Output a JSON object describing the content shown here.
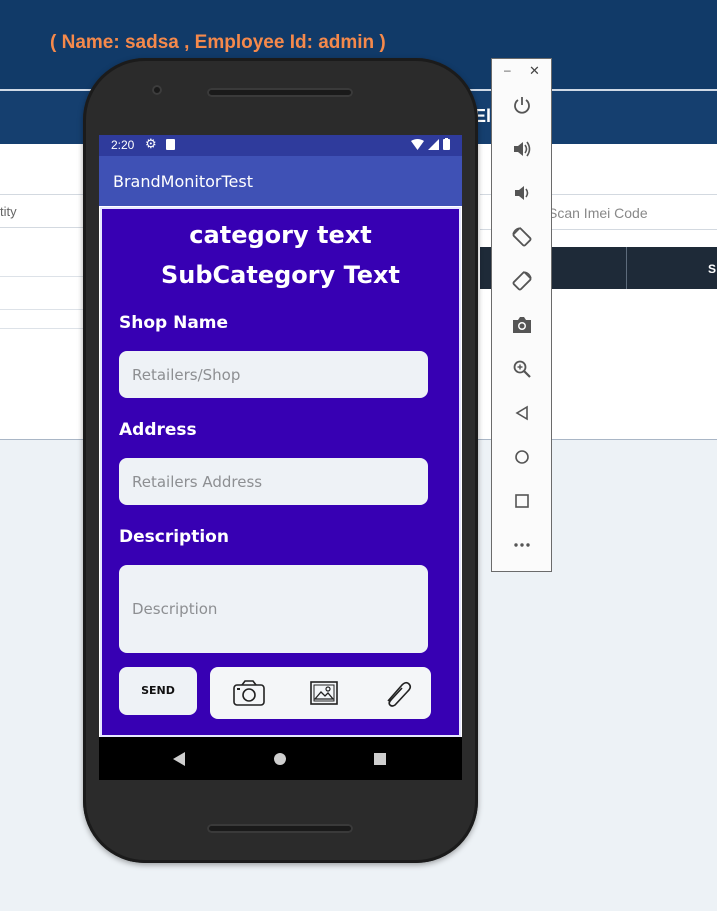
{
  "web_page": {
    "user_info": "( Name: sadsa , Employee Id: admin )",
    "section_title_fragment": "El    ers\"",
    "left_field_fragment": "tity",
    "imei_placeholder": "Scan Imei Code",
    "table_header_fragment": "S"
  },
  "phone": {
    "status_bar": {
      "time": "2:20"
    },
    "app_bar": {
      "title": "BrandMonitorTest"
    },
    "form": {
      "category": "category text",
      "subcategory": "SubCategory Text",
      "shop_label": "Shop Name",
      "shop_placeholder": "Retailers/Shop",
      "address_label": "Address",
      "address_placeholder": "Retailers Address",
      "description_label": "Description",
      "description_placeholder": "Description",
      "send_label": "SEND"
    }
  },
  "colors": {
    "web_header": "#113a68",
    "user_info_text": "#f5894b",
    "app_bar": "#3f51b5",
    "status_bar": "#2f3b9c",
    "form_background": "#3700b3"
  },
  "icons": [
    "camera-icon",
    "image-icon",
    "paperclip-icon",
    "back-icon",
    "home-icon",
    "recents-icon",
    "power-icon",
    "volume-up-icon",
    "volume-down-icon",
    "rotate-left-icon",
    "rotate-right-icon",
    "screenshot-icon",
    "zoom-icon",
    "overview-icon",
    "more-icon"
  ]
}
